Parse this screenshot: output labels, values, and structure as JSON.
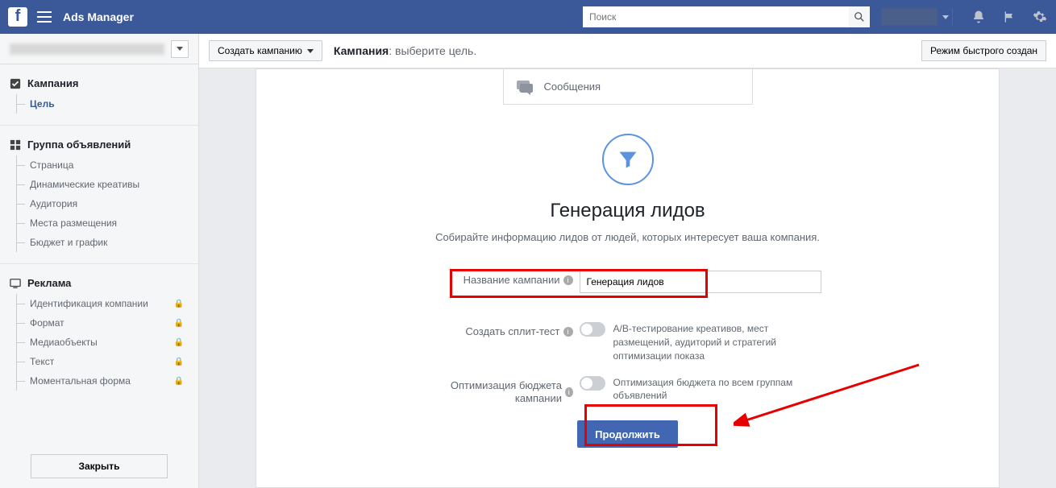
{
  "topbar": {
    "app_title": "Ads Manager",
    "search_placeholder": "Поиск"
  },
  "sidebar": {
    "campaign": {
      "header": "Кампания",
      "items": [
        "Цель"
      ]
    },
    "adset": {
      "header": "Группа объявлений",
      "items": [
        "Страница",
        "Динамические креативы",
        "Аудитория",
        "Места размещения",
        "Бюджет и график"
      ]
    },
    "ad": {
      "header": "Реклама",
      "items": [
        "Идентификация компании",
        "Формат",
        "Медиаобъекты",
        "Текст",
        "Моментальная форма"
      ]
    },
    "close": "Закрыть"
  },
  "secondbar": {
    "create_campaign": "Создать кампанию",
    "breadcrumb_bold": "Кампания",
    "breadcrumb_rest": ": выберите цель.",
    "mode_button": "Режим быстрого создан"
  },
  "content": {
    "option_messages": "Сообщения",
    "heading": "Генерация лидов",
    "description": "Собирайте информацию лидов от людей, которых интересует ваша компания.",
    "name_label": "Название кампании",
    "name_value": "Генерация лидов",
    "split_label": "Создать сплит-тест",
    "split_desc": "A/B-тестирование креативов, мест размещений, аудиторий и стратегий оптимизации показа",
    "budget_label": "Оптимизация бюджета кампании",
    "budget_desc": "Оптимизация бюджета по всем группам объявлений",
    "continue": "Продолжить"
  }
}
